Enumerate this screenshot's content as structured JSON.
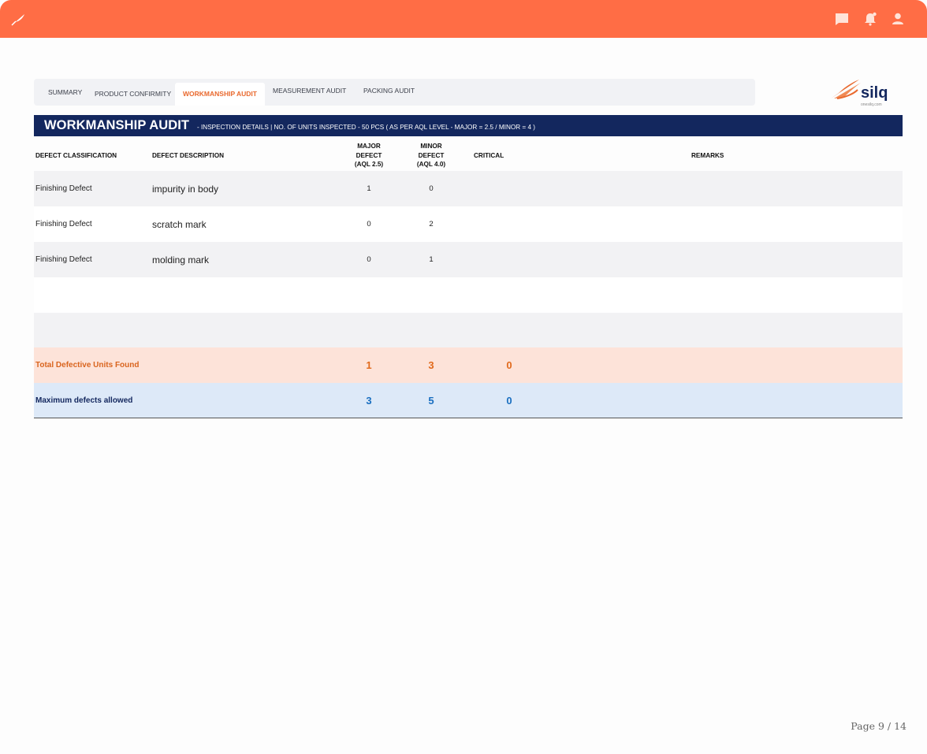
{
  "topbar": {
    "logo_icon": "quill-logo-icon",
    "icons": [
      "chat-icon",
      "bell-icon",
      "user-icon"
    ],
    "color": "#ff6d45"
  },
  "tabs": [
    {
      "label": "SUMMARY",
      "active": false
    },
    {
      "label": "PRODUCT CONFIRMITY",
      "active": false
    },
    {
      "label": "WORKMANSHIP AUDIT",
      "active": true
    },
    {
      "label": "MEASUREMENT AUDIT",
      "active": false
    },
    {
      "label": "PACKING AUDIT",
      "active": false
    }
  ],
  "brand": {
    "name": "silq",
    "url": "onesilq.com"
  },
  "banner": {
    "title": "WORKMANSHIP AUDIT",
    "subtitle": "-  INSPECTION DETAILS | NO. OF UNITS INSPECTED - 50 PCS ( AS PER AQL LEVEL -  MAJOR = 2.5 / MINOR = 4 )"
  },
  "table": {
    "headers": {
      "classification": "DEFECT CLASSIFICATION",
      "description": "DEFECT DESCRIPTION",
      "major_1": "MAJOR",
      "major_2": "DEFECT",
      "major_3": "(AQL 2.5)",
      "minor_1": "MINOR",
      "minor_2": "DEFECT",
      "minor_3": "(AQL 4.0)",
      "critical": "CRITICAL",
      "remarks": "REMARKS"
    },
    "rows": [
      {
        "classification": "Finishing Defect",
        "description": "impurity in body",
        "major": "1",
        "minor": "0",
        "critical": "",
        "remarks": ""
      },
      {
        "classification": "Finishing Defect",
        "description": "scratch mark",
        "major": "0",
        "minor": "2",
        "critical": "",
        "remarks": ""
      },
      {
        "classification": "Finishing Defect",
        "description": "molding mark",
        "major": "0",
        "minor": "1",
        "critical": "",
        "remarks": ""
      }
    ],
    "total": {
      "label": "Total Defective Units Found",
      "major": "1",
      "minor": "3",
      "critical": "0"
    },
    "max": {
      "label": "Maximum defects allowed",
      "major": "3",
      "minor": "5",
      "critical": "0"
    }
  },
  "footer": {
    "page": "Page 9 / 14"
  },
  "colors": {
    "accent": "#ff6d45",
    "navy": "#13275e",
    "orange_text": "#e16a1c",
    "blue_text": "#1a6fc0"
  }
}
